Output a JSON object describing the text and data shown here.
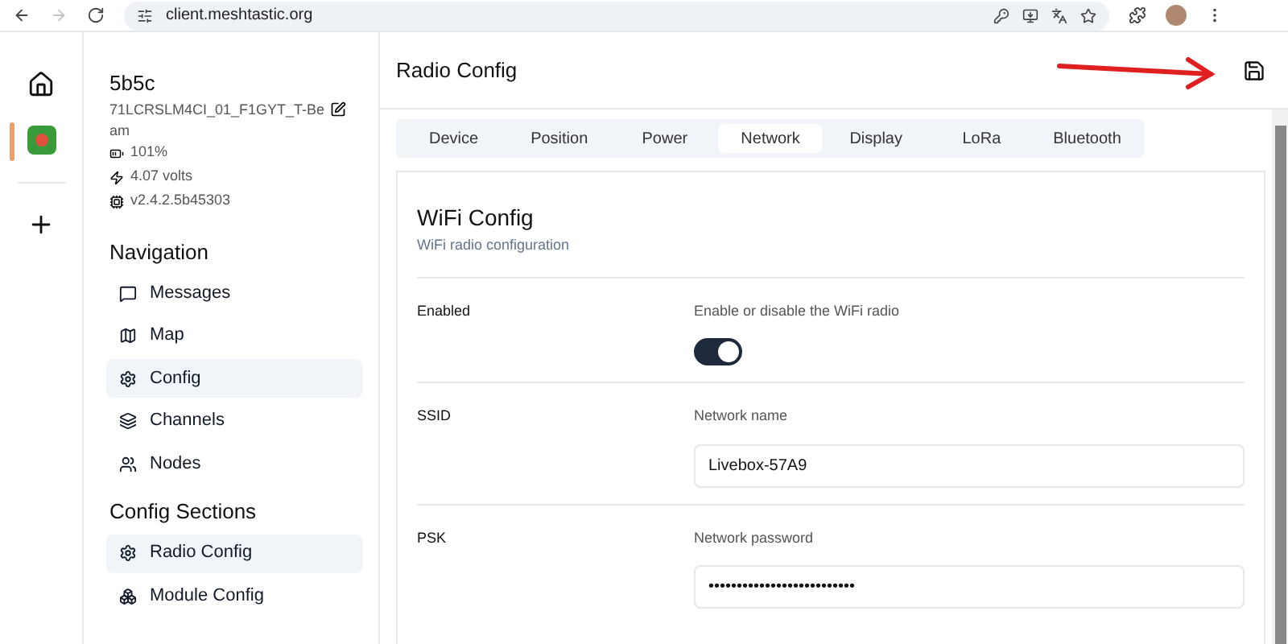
{
  "browser": {
    "url": "client.meshtastic.org",
    "forward_disabled": true
  },
  "device": {
    "name": "5b5c",
    "id": "71LCRSLM4CI_01_F1GYT_T-Beam",
    "battery": "101%",
    "voltage": "4.07 volts",
    "firmware": "v2.4.2.5b45303"
  },
  "navigation": {
    "title": "Navigation",
    "items": [
      {
        "label": "Messages",
        "selected": false
      },
      {
        "label": "Map",
        "selected": false
      },
      {
        "label": "Config",
        "selected": true
      },
      {
        "label": "Channels",
        "selected": false
      },
      {
        "label": "Nodes",
        "selected": false
      }
    ]
  },
  "config_sections": {
    "title": "Config Sections",
    "items": [
      {
        "label": "Radio Config",
        "selected": true
      },
      {
        "label": "Module Config",
        "selected": false
      }
    ]
  },
  "header": {
    "title": "Radio Config"
  },
  "tabs": [
    {
      "label": "Device",
      "selected": false
    },
    {
      "label": "Position",
      "selected": false
    },
    {
      "label": "Power",
      "selected": false
    },
    {
      "label": "Network",
      "selected": true
    },
    {
      "label": "Display",
      "selected": false
    },
    {
      "label": "LoRa",
      "selected": false
    },
    {
      "label": "Bluetooth",
      "selected": false
    }
  ],
  "section": {
    "title": "WiFi Config",
    "description": "WiFi radio configuration"
  },
  "fields": [
    {
      "kind": "toggle",
      "label": "Enabled",
      "description": "Enable or disable the WiFi radio",
      "on": true
    },
    {
      "kind": "text",
      "label": "SSID",
      "description": "Network name",
      "value": "Livebox-57A9"
    },
    {
      "kind": "text",
      "label": "PSK",
      "description": "Network password",
      "value": "••••••••••••••••••••••••••"
    }
  ]
}
